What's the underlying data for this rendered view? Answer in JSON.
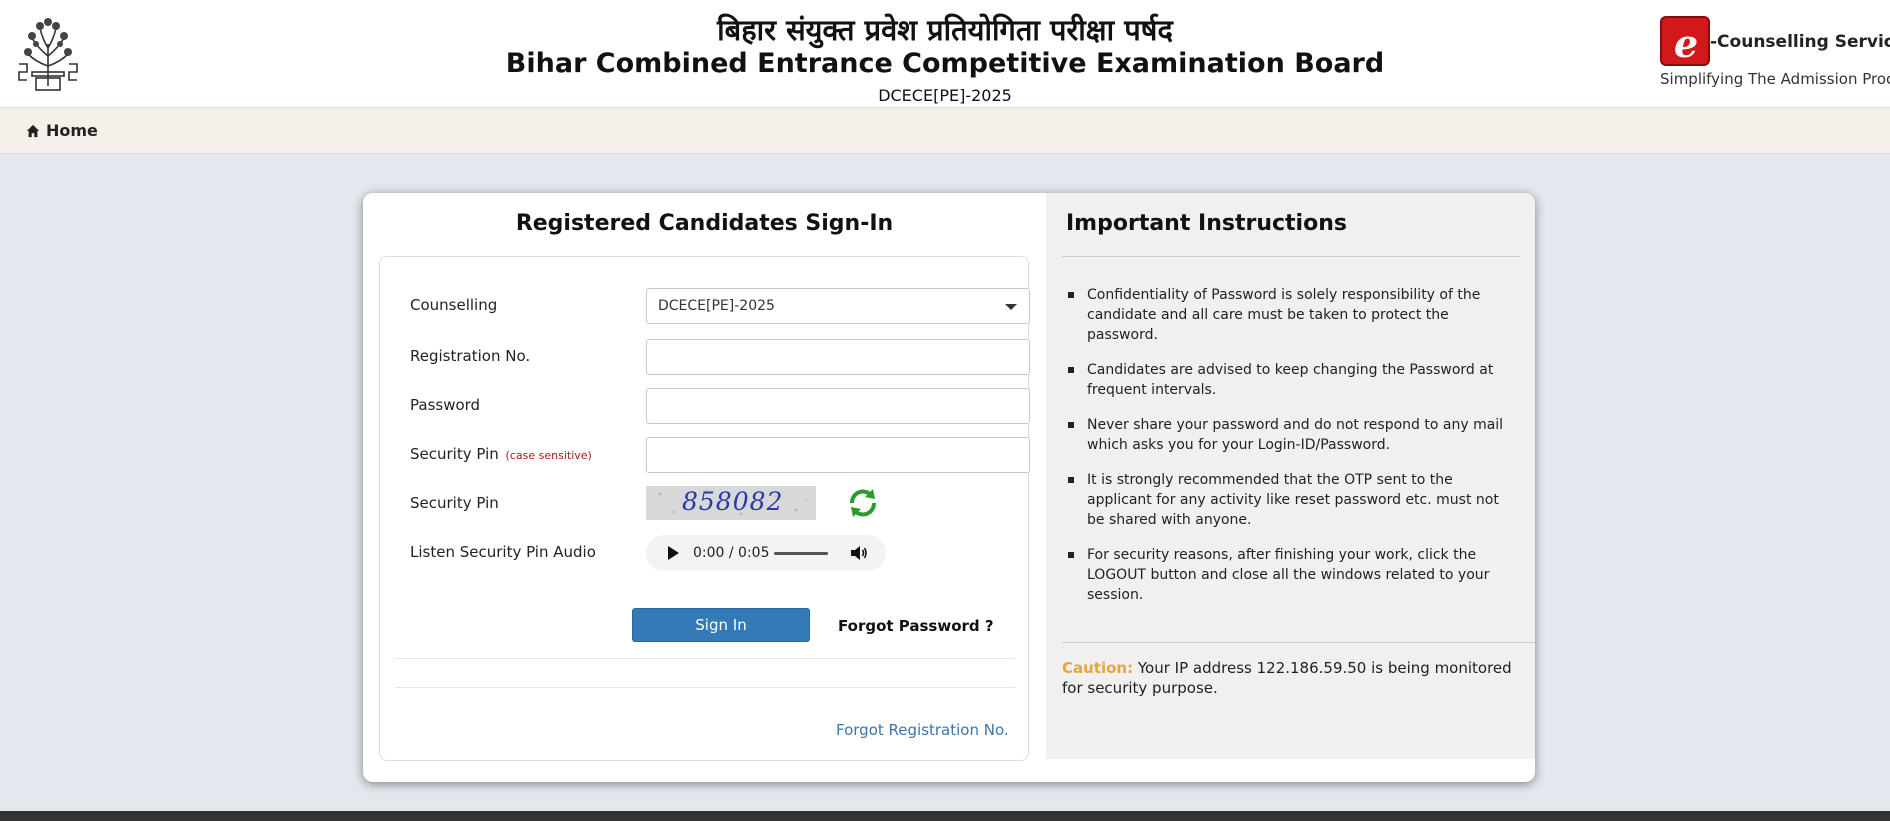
{
  "header": {
    "title_hindi": "बिहार संयुक्त प्रवेश प्रतियोगिता परीक्षा पर्षद",
    "title_english": "Bihar Combined Entrance Competitive Examination Board",
    "subtitle": "DCECE[PE]-2025",
    "logo_left_icon": "bceceb-tree-logo-icon",
    "brand_title": "-Counselling Services",
    "brand_tagline": "Simplifying The Admission Process",
    "brand_icon": "e-letter-logo-icon",
    "brand_color": "#d21818"
  },
  "nav": {
    "home_label": "Home",
    "home_icon": "home-icon"
  },
  "form": {
    "title": "Registered Candidates Sign-In",
    "counselling_label": "Counselling",
    "counselling_value": "DCECE[PE]-2025",
    "registration_label": "Registration No.",
    "registration_value": "",
    "password_label": "Password",
    "password_value": "",
    "security_pin_label": "Security Pin",
    "security_pin_note": "(case sensitive)",
    "security_pin_value": "",
    "captcha_label": "Security Pin",
    "captcha_text": "858082",
    "refresh_icon": "refresh-icon",
    "audio_label": "Listen Security Pin Audio",
    "audio_time": "0:00 / 0:05",
    "signin_label": "Sign In",
    "forgot_password_label": "Forgot Password ?",
    "forgot_registration_label": "Forgot Registration No.",
    "accent_color": "#337ab7"
  },
  "instructions": {
    "title": "Important Instructions",
    "items": [
      "Confidentiality of Password is solely responsibility of the candidate and all care must be taken to protect the password.",
      "Candidates are advised to keep changing the Password at frequent intervals.",
      "Never share your password and do not respond to any mail which asks you for your Login-ID/Password.",
      "It is strongly recommended that the OTP sent to the applicant for any activity like reset password etc. must not be shared with anyone.",
      "For security reasons, after finishing your work, click the LOGOUT button and close all the windows related to your session."
    ],
    "caution_label": "Caution:",
    "caution_text": " Your IP address 122.186.59.50 is being monitored for security purpose.",
    "caution_color": "#e8a53a"
  }
}
